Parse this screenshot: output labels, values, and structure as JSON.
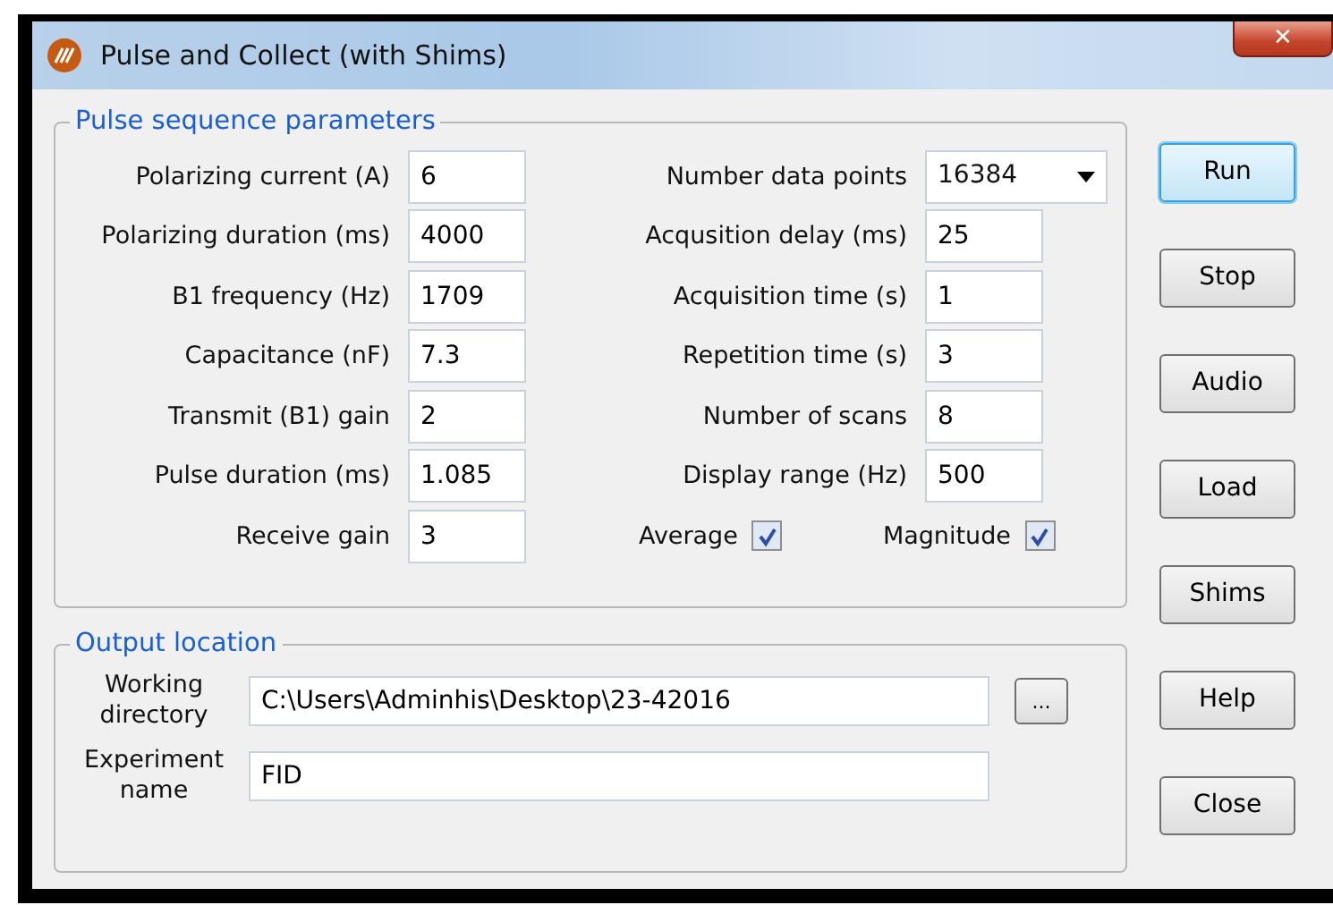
{
  "window": {
    "title": "Pulse and Collect (with Shims)",
    "close": "✕"
  },
  "pulse_group": {
    "title": "Pulse sequence parameters",
    "left_fields": [
      {
        "label": "Polarizing current (A)",
        "value": "6"
      },
      {
        "label": "Polarizing duration (ms)",
        "value": "4000"
      },
      {
        "label": "B1 frequency (Hz)",
        "value": "1709"
      },
      {
        "label": "Capacitance (nF)",
        "value": "7.3"
      },
      {
        "label": "Transmit (B1) gain",
        "value": "2"
      },
      {
        "label": "Pulse duration (ms)",
        "value": "1.085"
      },
      {
        "label": "Receive gain",
        "value": "3"
      }
    ],
    "right_fields": [
      {
        "kind": "dropdown",
        "label": "Number data points",
        "value": "16384"
      },
      {
        "kind": "text",
        "label": "Acqusition delay (ms)",
        "value": "25"
      },
      {
        "kind": "text",
        "label": "Acquisition time (s)",
        "value": "1"
      },
      {
        "kind": "text",
        "label": "Repetition time (s)",
        "value": "3"
      },
      {
        "kind": "text",
        "label": "Number of scans",
        "value": "8"
      },
      {
        "kind": "text",
        "label": "Display range (Hz)",
        "value": "500"
      }
    ],
    "checkboxes": [
      {
        "label": "Average",
        "checked": true
      },
      {
        "label": "Magnitude",
        "checked": true
      }
    ]
  },
  "output_group": {
    "title": "Output location",
    "fields": [
      {
        "label": "Working directory",
        "value": "C:\\Users\\Adminhis\\Desktop\\23-42016",
        "browse": "..."
      },
      {
        "label": "Experiment name",
        "value": "FID"
      }
    ]
  },
  "buttons": [
    {
      "label": "Run",
      "focused": true
    },
    {
      "label": "Stop",
      "focused": false
    },
    {
      "label": "Audio",
      "focused": false
    },
    {
      "label": "Load",
      "focused": false
    },
    {
      "label": "Shims",
      "focused": false
    },
    {
      "label": "Help",
      "focused": false
    },
    {
      "label": "Close",
      "focused": false
    }
  ]
}
